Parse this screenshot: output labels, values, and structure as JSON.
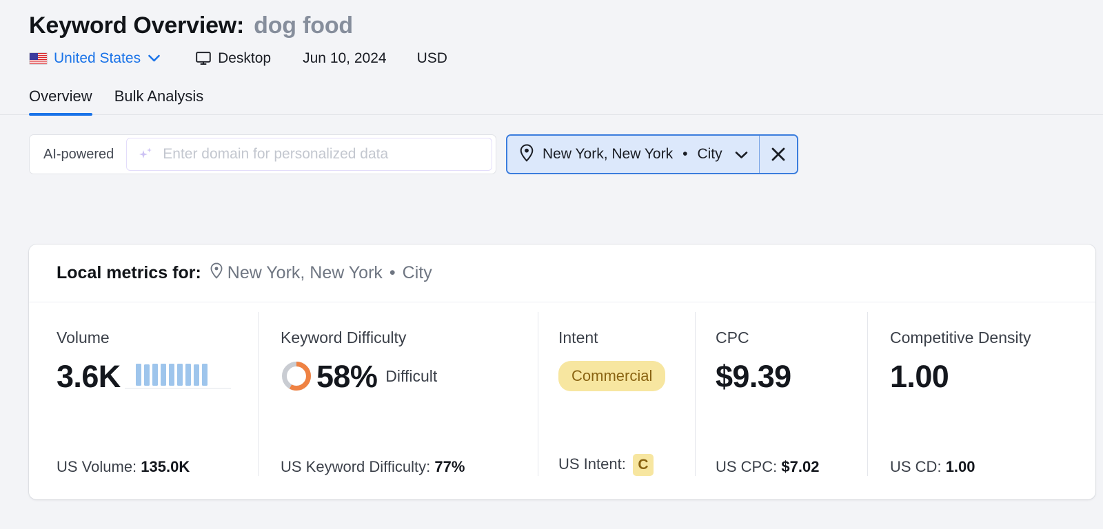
{
  "header": {
    "title_prefix": "Keyword Overview:",
    "keyword": "dog food",
    "country": "United States",
    "country_flag_icon": "us-flag-icon",
    "device": "Desktop",
    "device_icon": "monitor-icon",
    "date": "Jun 10, 2024",
    "currency": "USD"
  },
  "tabs": [
    {
      "label": "Overview",
      "active": true
    },
    {
      "label": "Bulk Analysis",
      "active": false
    }
  ],
  "controls": {
    "ai_badge": "AI-powered",
    "domain_placeholder": "Enter domain for personalized data",
    "domain_value": "",
    "sparkle_icon": "sparkle-icon",
    "location": {
      "pin_icon": "location-pin-icon",
      "name": "New York, New York",
      "separator": "•",
      "type": "City",
      "chevron_icon": "chevron-down-icon",
      "close_icon": "close-icon"
    }
  },
  "card": {
    "head_label": "Local metrics for:",
    "head_pin_icon": "location-pin-icon",
    "head_location": "New York, New York",
    "head_separator": "•",
    "head_type": "City",
    "metrics": {
      "volume": {
        "label": "Volume",
        "value": "3.6K",
        "sub_label": "US Volume:",
        "sub_value": "135.0K"
      },
      "keyword_difficulty": {
        "label": "Keyword Difficulty",
        "value": "58%",
        "percent": 58,
        "qualifier": "Difficult",
        "sub_label": "US Keyword Difficulty:",
        "sub_value": "77%"
      },
      "intent": {
        "label": "Intent",
        "badge": "Commercial",
        "sub_label": "US Intent:",
        "sub_value": "C"
      },
      "cpc": {
        "label": "CPC",
        "value": "$9.39",
        "sub_label": "US CPC:",
        "sub_value": "$7.02"
      },
      "competitive_density": {
        "label": "Competitive Density",
        "value": "1.00",
        "sub_label": "US CD:",
        "sub_value": "1.00"
      }
    }
  },
  "chart_data": {
    "type": "bar",
    "title": "Volume trend sparkline",
    "categories": [
      "1",
      "2",
      "3",
      "4",
      "5",
      "6",
      "7",
      "8",
      "9"
    ],
    "values": [
      30,
      29,
      30,
      30,
      30,
      30,
      30,
      29,
      30
    ],
    "xlabel": "",
    "ylabel": "",
    "ylim": [
      0,
      32
    ],
    "grid": false,
    "legend": "none",
    "series_color": "#9ec5ec"
  },
  "colors": {
    "accent_blue": "#1a73e8",
    "page_bg": "#f3f4f7",
    "card_bg": "#ffffff",
    "kd_arc": "#ef8243",
    "kd_track": "#c9ccd2",
    "intent_bg": "#f7e6a0",
    "intent_fg": "#8a6412",
    "spark_bar": "#9ec5ec"
  }
}
